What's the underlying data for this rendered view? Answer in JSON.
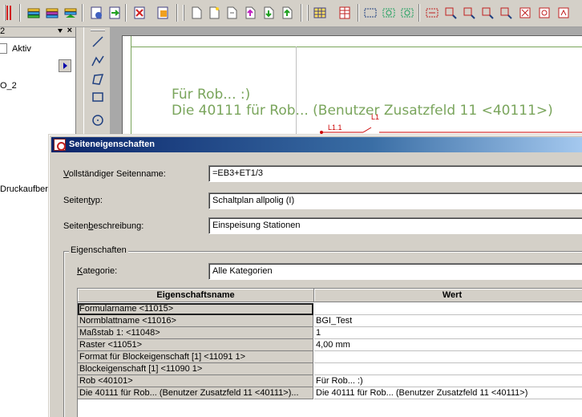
{
  "toolbar": {
    "icons": [
      "redbar-icon",
      "stack-icon",
      "stack-icon",
      "stack-arrow-icon",
      "sheet-gear-icon",
      "sheet-arrow-icon",
      "sheet-cross-icon",
      "sheet-select-icon",
      "page-icon",
      "page-new-icon",
      "page-copy-icon",
      "page-up-icon",
      "page-left-icon",
      "page-right-icon",
      "grid-icon",
      "table-icon",
      "frame-icon",
      "frame-plus-icon",
      "frame-arrow-icon",
      "dotted-frame-icon",
      "symbol-icon",
      "symbol-plus-icon",
      "symbol-arrow-icon",
      "box-cross-icon",
      "box-symbol-icon"
    ]
  },
  "left_panel": {
    "header_number": "2",
    "close_glyph": "×",
    "aktiv_label": "Aktiv",
    "list_item": "O_2",
    "druck_text": "Druckaufber"
  },
  "canvas": {
    "line1": "Für Rob... :)",
    "line2": "Die 40111 für Rob... (Benutzer Zusatzfeld 11 <40111>)",
    "red_label_1": "L1.1",
    "red_label_2": "L1"
  },
  "dialog": {
    "title": "Seiteneigenschaften",
    "full_name": {
      "label_underlined": "V",
      "label_rest": "ollständiger Seitenname:",
      "value": "=EB3+ET1/3"
    },
    "page_type": {
      "label_pre": "Seiten",
      "label_underlined": "t",
      "label_rest": "yp:",
      "value": "Schaltplan allpolig (I)"
    },
    "page_desc": {
      "label_pre": "Seiten",
      "label_underlined": "b",
      "label_rest": "eschreibung:",
      "value": "Einspeisung Stationen"
    },
    "group_title": "Eigenschaften",
    "category": {
      "label_underlined": "K",
      "label_rest": "ategorie:",
      "value": "Alle Kategorien"
    },
    "grid": {
      "col_name": "Eigenschaftsname",
      "col_value": "Wert",
      "rows": [
        {
          "name": "Formularname <11015>",
          "value": ""
        },
        {
          "name": "Normblattname <11016>",
          "value": "BGI_Test"
        },
        {
          "name": "Maßstab 1: <11048>",
          "value": "1"
        },
        {
          "name": "Raster <11051>",
          "value": "4,00 mm"
        },
        {
          "name": "Format für Blockeigenschaft [1] <11091 1>",
          "value": ""
        },
        {
          "name": "Blockeigenschaft [1] <11090 1>",
          "value": ""
        },
        {
          "name": "Rob <40101>",
          "value": "Für Rob... :)"
        },
        {
          "name": "Die 40111 für Rob... (Benutzer Zusatzfeld 11 <40111>)...",
          "value": "Die 40111 für Rob... (Benutzer Zusatzfeld 11 <40111>)"
        }
      ]
    }
  }
}
